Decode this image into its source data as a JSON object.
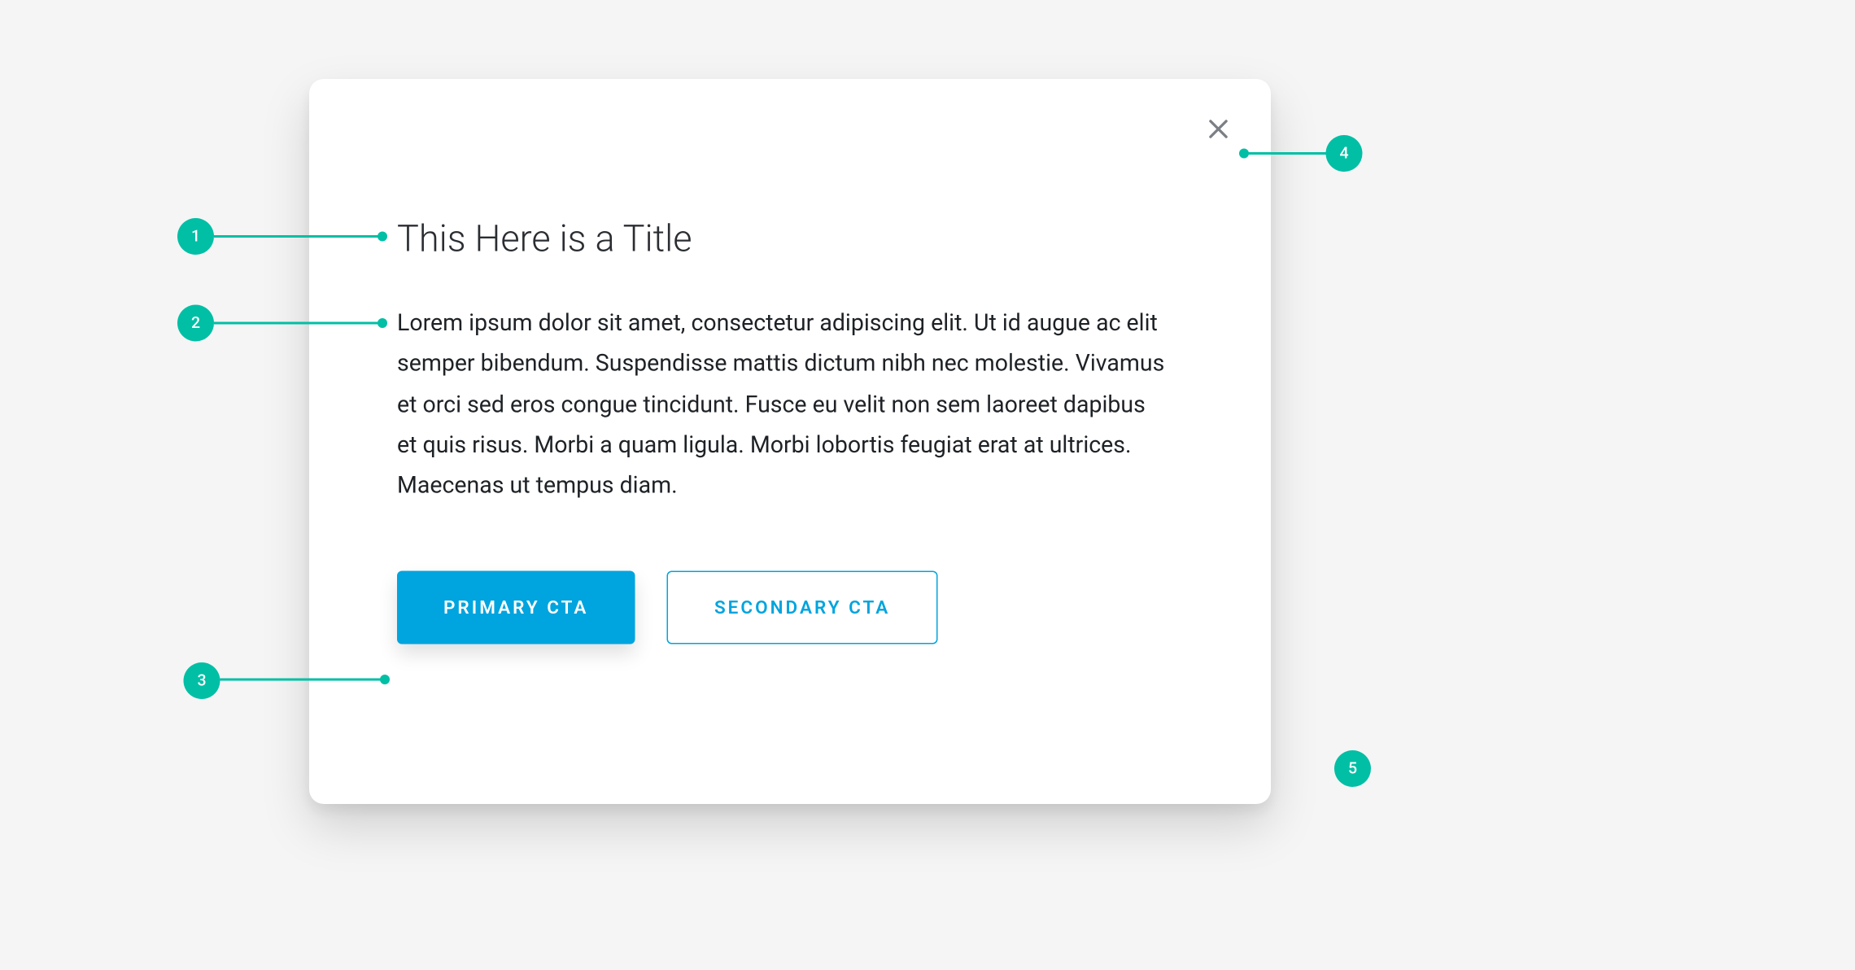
{
  "modal": {
    "title": "This Here is a Title",
    "body": "Lorem ipsum dolor sit amet, consectetur adipiscing elit. Ut id augue ac elit semper bibendum. Suspendisse mattis dictum nibh nec molestie. Vivamus et orci sed eros congue tincidunt. Fusce eu velit non sem laoreet dapibus et quis risus. Morbi a quam ligula. Morbi lobortis feugiat erat at ultrices. Maecenas ut tempus diam.",
    "primary_cta": "PRIMARY CTA",
    "secondary_cta": "SECONDARY CTA"
  },
  "annotations": {
    "m1": "1",
    "m2": "2",
    "m3": "3",
    "m4": "4",
    "m5": "5"
  },
  "colors": {
    "accent_button": "#00a4de",
    "annotation": "#00bfa5"
  }
}
